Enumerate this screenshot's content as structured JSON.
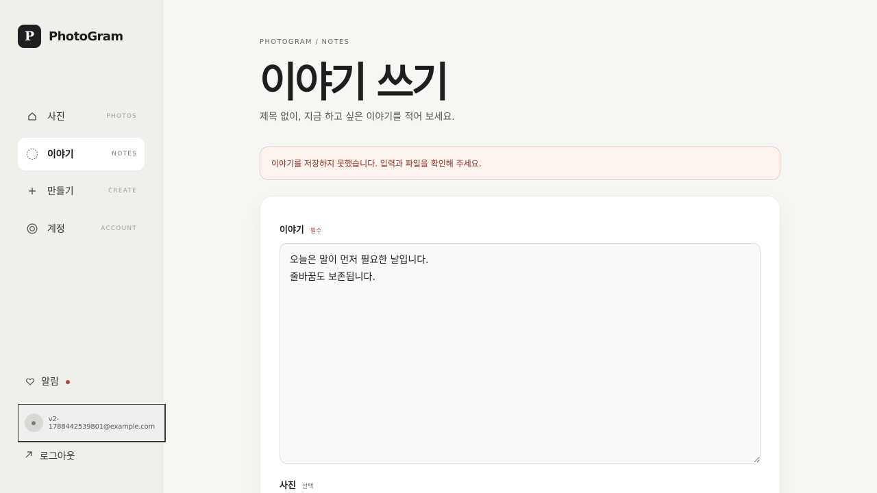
{
  "brand": {
    "logo_letter": "P",
    "name": "PhotoGram"
  },
  "nav": {
    "items": [
      {
        "label": "사진",
        "sub": "PHOTOS",
        "icon": "home-icon"
      },
      {
        "label": "이야기",
        "sub": "NOTES",
        "icon": "circle-dashed-icon",
        "active": true
      },
      {
        "label": "만들기",
        "sub": "CREATE",
        "icon": "plus-icon"
      },
      {
        "label": "계정",
        "sub": "ACCOUNT",
        "icon": "target-icon"
      }
    ]
  },
  "alarm": {
    "label": "알림",
    "icon": "heart-icon",
    "has_unread": true,
    "dot_color": "#b5443a"
  },
  "account": {
    "email": "v2-1788442539801@example.com"
  },
  "logout": {
    "label": "로그아웃",
    "icon": "arrow-up-right-icon"
  },
  "main": {
    "breadcrumb": "PHOTOGRAM / NOTES",
    "title": "이야기 쓰기",
    "subtitle": "제목 없이, 지금 하고 싶은 이야기를 적어 보세요.",
    "error": "이야기를 저장하지 못했습니다. 입력과 파일을 확인해 주세요.",
    "story_field": {
      "label": "이야기",
      "tag": "필수",
      "value": "오늘은 말이 먼저 필요한 날입니다.\n줄바꿈도 보존됩니다."
    },
    "photo_field": {
      "label": "사진",
      "tag": "선택"
    }
  },
  "colors": {
    "accent_dark": "#1f1f1f",
    "error_text": "#8a3325",
    "error_bg": "#fdf3ef"
  }
}
